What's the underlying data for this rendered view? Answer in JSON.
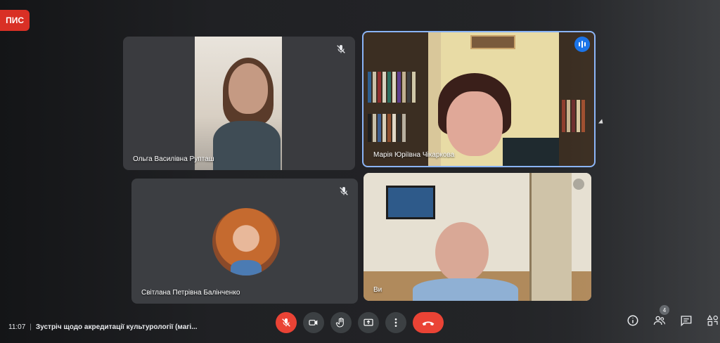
{
  "recording_badge": "ПИС",
  "participants": [
    {
      "name": "Ольга Василівна Рупташ",
      "muted": true
    },
    {
      "name": "Марія Юріївна Чікаркова",
      "muted": false,
      "speaking": true
    },
    {
      "name": "Світлана Петрівна Балінченко",
      "muted": true
    },
    {
      "name": "Ви",
      "muted": false
    }
  ],
  "meeting": {
    "time": "11:07",
    "separator": "|",
    "title": "Зустріч щодо акредитації культурології (магі..."
  },
  "controls": {
    "mic": "mic-off-icon",
    "camera": "videocam-icon",
    "raise_hand": "hand-icon",
    "present": "present-screen-icon",
    "more": "more-vert-icon",
    "hangup": "call-end-icon"
  },
  "side_panel": {
    "info": "info-icon",
    "people": "people-icon",
    "people_count": "4",
    "chat": "chat-icon",
    "activities": "activities-icon"
  },
  "colors": {
    "accent": "#8ab4f8",
    "danger": "#ea4335",
    "tile": "#3c4043"
  }
}
